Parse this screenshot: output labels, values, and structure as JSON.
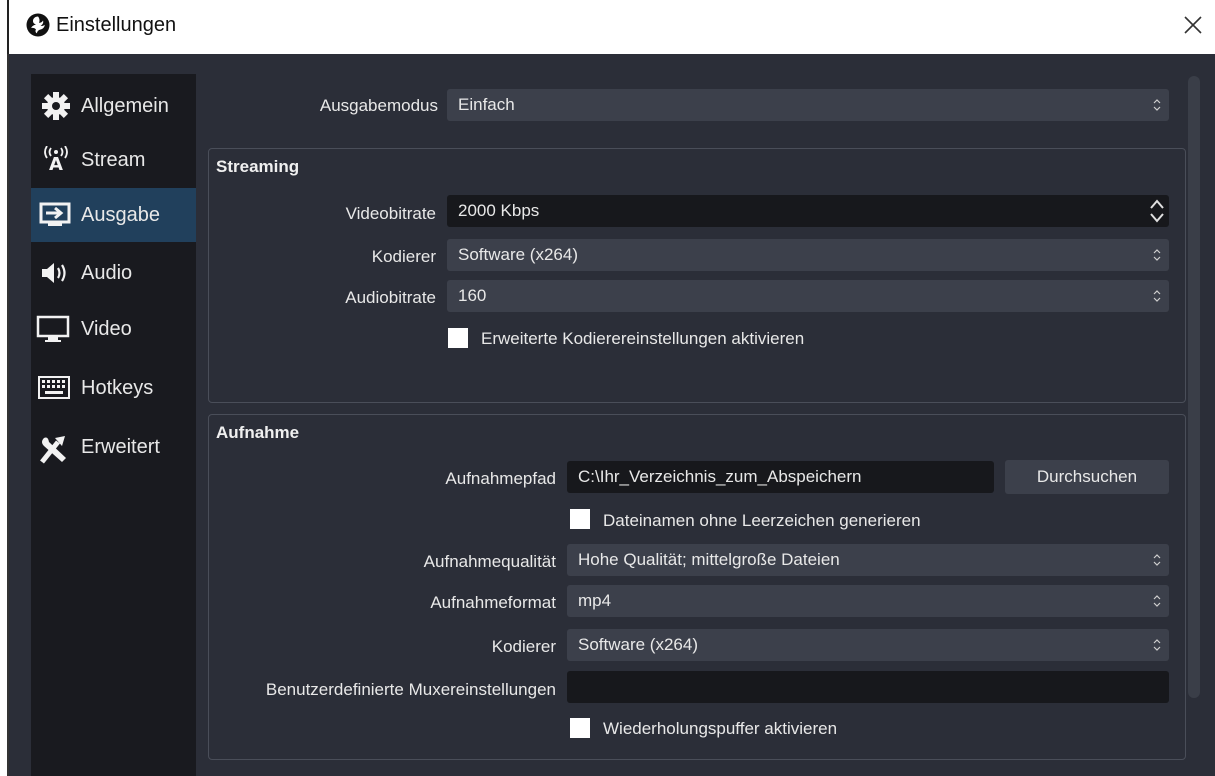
{
  "window": {
    "title": "Einstellungen"
  },
  "sidebar": {
    "items": [
      {
        "label": "Allgemein",
        "icon": "gear-icon"
      },
      {
        "label": "Stream",
        "icon": "broadcast-antenna-icon"
      },
      {
        "label": "Ausgabe",
        "icon": "output-monitor-icon",
        "active": true
      },
      {
        "label": "Audio",
        "icon": "speaker-icon"
      },
      {
        "label": "Video",
        "icon": "monitor-icon"
      },
      {
        "label": "Hotkeys",
        "icon": "keyboard-icon"
      },
      {
        "label": "Erweitert",
        "icon": "tools-icon"
      }
    ]
  },
  "output": {
    "mode_label": "Ausgabemodus",
    "mode_value": "Einfach"
  },
  "streaming": {
    "title": "Streaming",
    "video_bitrate_label": "Videobitrate",
    "video_bitrate_value": "2000 Kbps",
    "encoder_label": "Kodierer",
    "encoder_value": "Software (x264)",
    "audio_bitrate_label": "Audiobitrate",
    "audio_bitrate_value": "160",
    "advanced_checkbox_label": "Erweiterte Kodierereinstellungen aktivieren"
  },
  "recording": {
    "title": "Aufnahme",
    "path_label": "Aufnahmepfad",
    "path_value": "C:\\Ihr_Verzeichnis_zum_Abspeichern",
    "browse_label": "Durchsuchen",
    "no_spaces_checkbox_label": "Dateinamen ohne Leerzeichen generieren",
    "quality_label": "Aufnahmequalität",
    "quality_value": "Hohe Qualität; mittelgroße Dateien",
    "format_label": "Aufnahmeformat",
    "format_value": "mp4",
    "encoder_label": "Kodierer",
    "encoder_value": "Software (x264)",
    "muxer_label": "Benutzerdefinierte Muxereinstellungen",
    "muxer_value": "",
    "replay_buffer_checkbox_label": "Wiederholungspuffer aktivieren"
  },
  "colors": {
    "background": "#2b2e38",
    "sidebar": "#191a1f",
    "active_item": "#21405c",
    "combo": "#3c404b",
    "field": "#17181c"
  }
}
